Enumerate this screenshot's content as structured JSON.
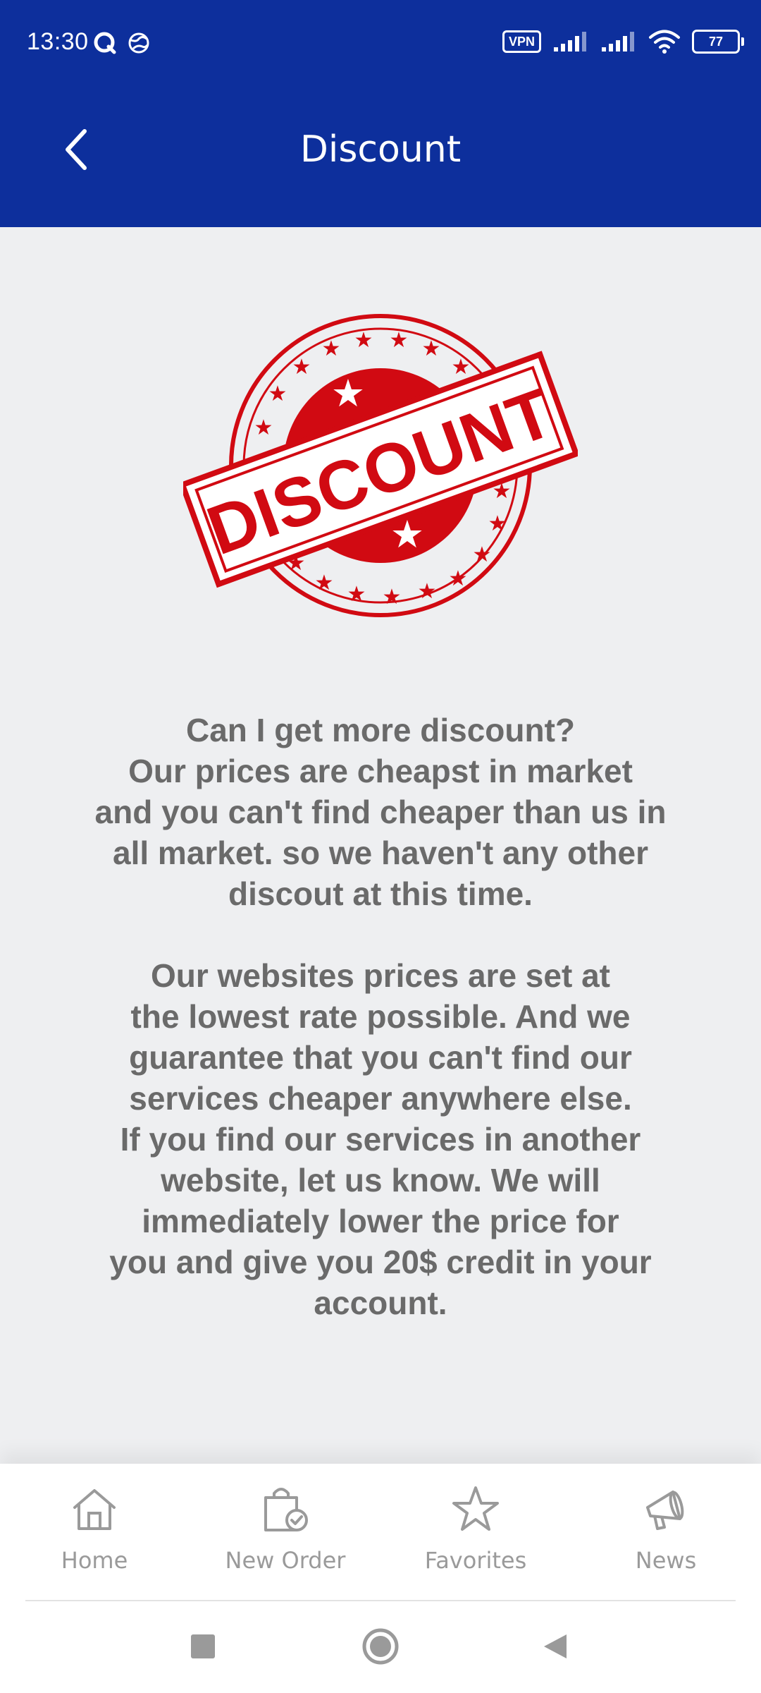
{
  "status_bar": {
    "time": "13:30",
    "vpn_label": "VPN",
    "battery": "77",
    "icons": [
      "q-icon",
      "globe-icon",
      "signal-icon",
      "signal-icon",
      "wifi-icon",
      "battery-icon"
    ]
  },
  "header": {
    "title": "Discount",
    "back_icon": "chevron-left-icon",
    "background": "#0d2f9c"
  },
  "stamp": {
    "text": "DISCOUNT",
    "color": "#d10a12"
  },
  "content": {
    "paragraph1": "Can I get more discount?\n Our prices are cheapst in market\nand you can't find cheaper than us in\nall market. so we haven't any other\ndiscout at this time.",
    "paragraph2": "  Our websites prices are set at\nthe lowest rate possible. And we\nguarantee that you can't find our\nservices cheaper anywhere else.\nIf you find our services in another\nwebsite, let us know. We will\nimmediately lower the price for\nyou and give you 20$ credit in your\naccount."
  },
  "bottom_nav": {
    "items": [
      {
        "label": "Home",
        "icon": "home-icon"
      },
      {
        "label": "New Order",
        "icon": "shopping-bag-check-icon"
      },
      {
        "label": "Favorites",
        "icon": "star-icon"
      },
      {
        "label": "News",
        "icon": "megaphone-icon"
      }
    ]
  },
  "system_nav": {
    "icons": [
      "square-recents-icon",
      "circle-home-icon",
      "triangle-back-icon"
    ]
  }
}
